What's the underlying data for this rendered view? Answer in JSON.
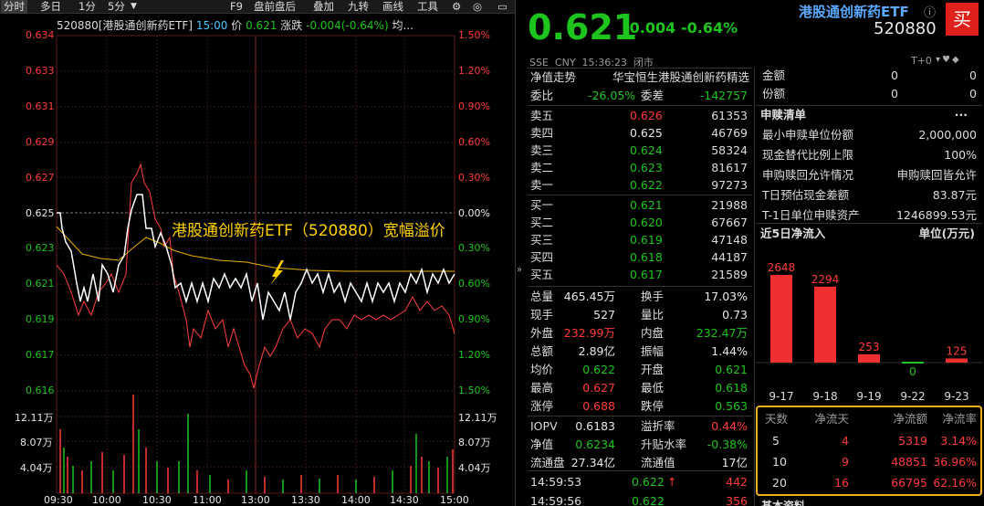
{
  "toolbar": {
    "items": [
      "分时",
      "多日",
      "1分",
      "5分",
      "F9",
      "盘前盘后",
      "叠加",
      "九转",
      "画线",
      "工具"
    ],
    "gear_icon": "gear-icon",
    "sound_icon": "speaker-icon"
  },
  "chart_header": {
    "name": "520880[港股通创新药ETF]",
    "time": "15:00",
    "price_label": "价",
    "price": "0.621",
    "chg_label": "涨跌",
    "chg": "-0.004(-0.64%)",
    "avg_label": "均..."
  },
  "y_left": [
    "0.634",
    "0.633",
    "0.631",
    "0.629",
    "0.627",
    "0.625",
    "0.623",
    "0.621",
    "0.619",
    "0.617",
    "0.616"
  ],
  "y_right": [
    "1.50%",
    "1.20%",
    "0.90%",
    "0.60%",
    "0.30%",
    "0.00%",
    "0.30%",
    "0.60%",
    "0.90%",
    "1.20%",
    "1.50%"
  ],
  "vol_left": [
    "12.11万",
    "8.07万",
    "4.04万"
  ],
  "vol_right": [
    "12.11万",
    "8.07万",
    "4.04万"
  ],
  "x_ticks": [
    "09:30",
    "10:00",
    "10:30",
    "11:00",
    "13:00",
    "13:30",
    "14:00",
    "14:30",
    "15:00"
  ],
  "annotation": "港股通创新药ETF（520880）宽幅溢价",
  "quote": {
    "price": "0.621",
    "chg": "-0.004",
    "pct": "-0.64%",
    "title": "港股通创新药ETF",
    "code": "520880",
    "buy_btn": "买",
    "info": "SSE  CNY  15:36:23  闭市",
    "t0": "T+0"
  },
  "nav_row": {
    "label": "净值走势",
    "name": "华宝恒生港股通创新药精选"
  },
  "weibi": {
    "l1": "委比",
    "v1": "-26.05%",
    "l2": "委差",
    "v2": "-142757"
  },
  "asks": [
    {
      "l": "卖五",
      "p": "0.626",
      "v": "61353",
      "c": "red"
    },
    {
      "l": "卖四",
      "p": "0.625",
      "v": "46769",
      "c": "white"
    },
    {
      "l": "卖三",
      "p": "0.624",
      "v": "58324",
      "c": "green"
    },
    {
      "l": "卖二",
      "p": "0.623",
      "v": "81617",
      "c": "green"
    },
    {
      "l": "卖一",
      "p": "0.622",
      "v": "97273",
      "c": "green"
    }
  ],
  "bids": [
    {
      "l": "买一",
      "p": "0.621",
      "v": "21988",
      "c": "green"
    },
    {
      "l": "买二",
      "p": "0.620",
      "v": "67667",
      "c": "green"
    },
    {
      "l": "买三",
      "p": "0.619",
      "v": "47148",
      "c": "green"
    },
    {
      "l": "买四",
      "p": "0.618",
      "v": "44187",
      "c": "green"
    },
    {
      "l": "买五",
      "p": "0.617",
      "v": "21589",
      "c": "green"
    }
  ],
  "stats": [
    {
      "l1": "总量",
      "v1": "465.45万",
      "c1": "white",
      "l2": "换手",
      "v2": "17.03%",
      "c2": "white"
    },
    {
      "l1": "现手",
      "v1": "527",
      "c1": "white",
      "l2": "量比",
      "v2": "0.73",
      "c2": "white"
    },
    {
      "l1": "外盘",
      "v1": "232.99万",
      "c1": "red",
      "l2": "内盘",
      "v2": "232.47万",
      "c2": "green"
    },
    {
      "l1": "总额",
      "v1": "2.89亿",
      "c1": "white",
      "l2": "振幅",
      "v2": "1.44%",
      "c2": "white"
    },
    {
      "l1": "均价",
      "v1": "0.622",
      "c1": "green",
      "l2": "开盘",
      "v2": "0.621",
      "c2": "green"
    },
    {
      "l1": "最高",
      "v1": "0.627",
      "c1": "red",
      "l2": "最低",
      "v2": "0.618",
      "c2": "green"
    },
    {
      "l1": "涨停",
      "v1": "0.688",
      "c1": "red",
      "l2": "跌停",
      "v2": "0.563",
      "c2": "green"
    }
  ],
  "iopv": [
    {
      "l1": "IOPV",
      "v1": "0.6183",
      "c1": "white",
      "l2": "溢折率",
      "v2": "0.44%",
      "c2": "red"
    },
    {
      "l1": "净值",
      "v1": "0.6234",
      "c1": "green",
      "l2": "升贴水率",
      "v2": "-0.38%",
      "c2": "green"
    },
    {
      "l1": "流通盘",
      "v1": "27.34亿",
      "c1": "white",
      "l2": "流通值",
      "v2": "17亿",
      "c2": "white"
    }
  ],
  "ticks": [
    {
      "t": "14:59:53",
      "p": "0.622",
      "arrow": "↑",
      "v": "442"
    },
    {
      "t": "14:59:56",
      "p": "0.622",
      "arrow": "",
      "v": "356"
    }
  ],
  "fund": [
    {
      "l": "金额",
      "a": "0",
      "b": "0"
    },
    {
      "l": "份额",
      "a": "0",
      "b": "0"
    }
  ],
  "subs": {
    "title": "申赎清单",
    "more": "···",
    "rows": [
      {
        "l": "最小申赎单位份额",
        "v": "2,000,000"
      },
      {
        "l": "现金替代比例上限",
        "v": "100%"
      },
      {
        "l": "申购赎回允许情况",
        "v": "申购赎回皆允许"
      },
      {
        "l": "T日预估现金差额",
        "v": "83.87元"
      },
      {
        "l": "T-1日单位申赎资产",
        "v": "1246899.53元"
      }
    ]
  },
  "flow": {
    "title": "近5日净流入",
    "unit": "单位(万元)"
  },
  "chart_data": {
    "type": "bar",
    "categories": [
      "9-17",
      "9-18",
      "9-19",
      "9-22",
      "9-23"
    ],
    "values": [
      2648,
      2294,
      253,
      0,
      125
    ],
    "ylim": [
      0,
      2648
    ]
  },
  "flow_table": {
    "headers": [
      "天数",
      "净流天",
      "净流额",
      "净流率"
    ],
    "rows": [
      [
        "5",
        "4",
        "5319",
        "3.14%"
      ],
      [
        "10",
        "9",
        "48851",
        "36.96%"
      ],
      [
        "20",
        "16",
        "66795",
        "62.16%"
      ]
    ]
  },
  "basic": "基本资料"
}
